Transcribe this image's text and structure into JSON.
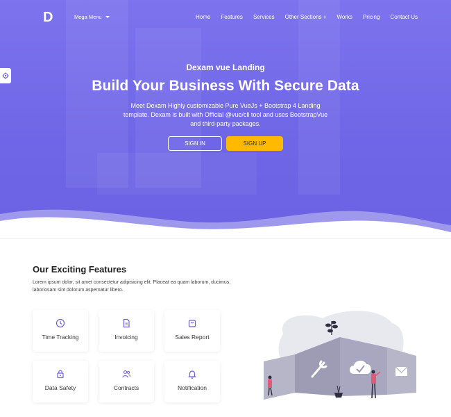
{
  "navbar": {
    "logo": "D",
    "mega_menu": "Mega Menu",
    "links": [
      "Home",
      "Features",
      "Services",
      "Other Sections +",
      "Works",
      "Pricing",
      "Contact Us"
    ]
  },
  "hero": {
    "subtitle": "Dexam vue Landing",
    "title": "Build Your Business With Secure Data",
    "description": "Meet Dexam Highly customizable Pure VueJs + Bootstrap 4 Landing template. Dexam is built with Official @vue/cli tool and uses BootstrapVue and third-party packages.",
    "signin_label": "SIGN IN",
    "signup_label": "SIGN UP"
  },
  "features": {
    "title": "Our Exciting Features",
    "description": "Lorem ipsum dolor, sit amet consectetur adipisicing elit. Placeat ea quam laborum, ducimus, laboriosam sint dolorum aspernatur libero.",
    "items": [
      {
        "label": "Time Tracking",
        "icon": "clock-icon"
      },
      {
        "label": "Invoicing",
        "icon": "invoice-icon"
      },
      {
        "label": "Sales Report",
        "icon": "bag-icon"
      },
      {
        "label": "Data Safety",
        "icon": "lock-icon"
      },
      {
        "label": "Contracts",
        "icon": "users-icon"
      },
      {
        "label": "Notification",
        "icon": "bell-icon"
      }
    ]
  },
  "colors": {
    "hero_purple": "#6e66e6",
    "accent_yellow": "#ffb900",
    "icon_purple": "#6b5ee0"
  }
}
